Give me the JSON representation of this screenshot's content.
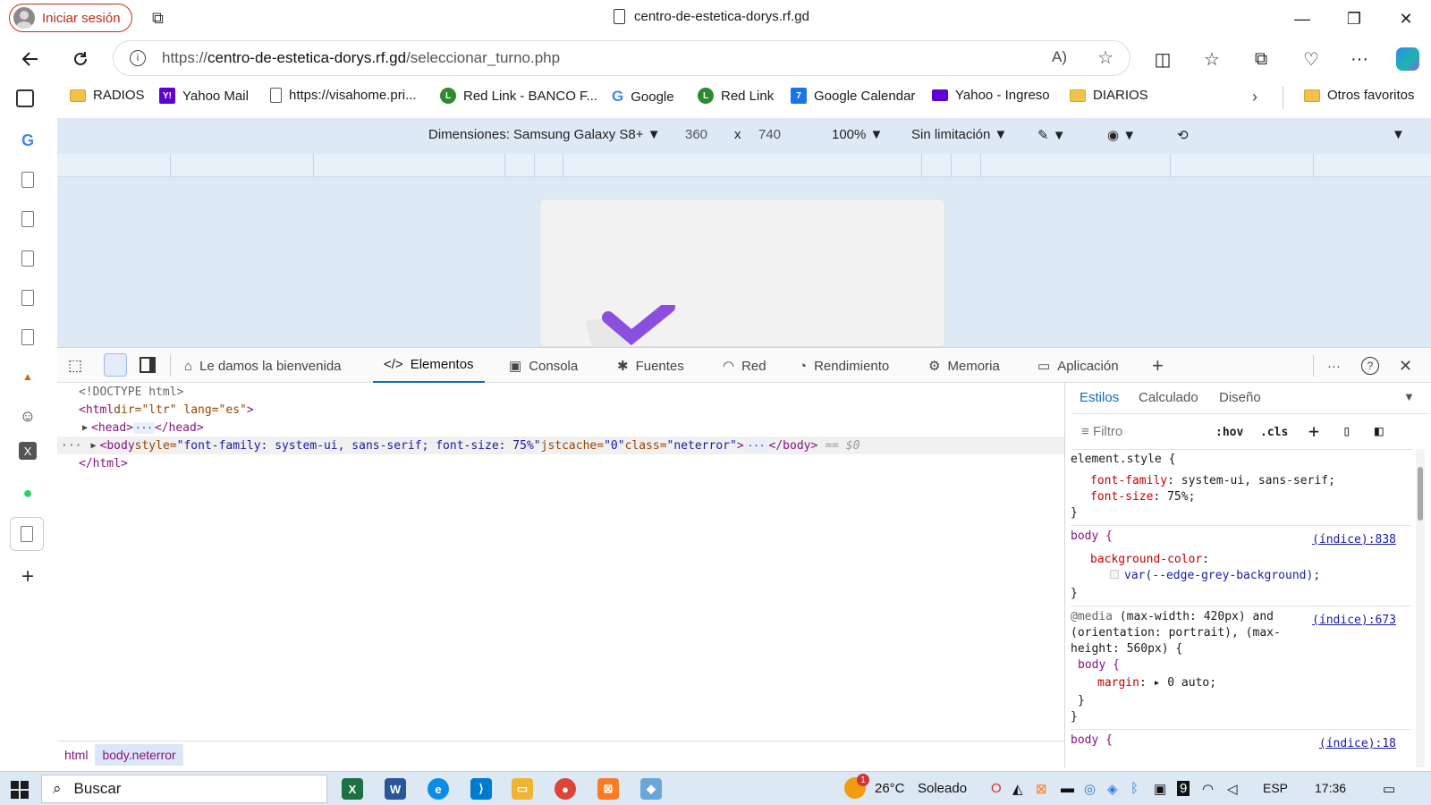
{
  "window": {
    "signin_label": "Iniciar sesión",
    "tab_title": "centro-de-estetica-dorys.rf.gd",
    "controls": {
      "minimize": "—",
      "restore": "❐",
      "close": "✕"
    }
  },
  "address": {
    "scheme": "https://",
    "host": "centro-de-estetica-dorys.rf.gd",
    "path": "/seleccionar_turno.php"
  },
  "bookmarks": [
    {
      "label": "RADIOS",
      "icon": "folder-icon"
    },
    {
      "label": "Yahoo Mail",
      "icon": "yahoo-icon"
    },
    {
      "label": "https://visahome.pri...",
      "icon": "page-icon"
    },
    {
      "label": "Red Link - BANCO F...",
      "icon": "redlink-icon"
    },
    {
      "label": "Google",
      "icon": "google-icon"
    },
    {
      "label": "Red Link",
      "icon": "redlink-icon"
    },
    {
      "label": "Google Calendar",
      "icon": "calendar-icon"
    },
    {
      "label": "Yahoo - Ingreso",
      "icon": "yahoo-mail-icon"
    },
    {
      "label": "DIARIOS",
      "icon": "folder-icon"
    }
  ],
  "bookmarks_other": "Otros favoritos",
  "emulation": {
    "device_label": "Dimensiones: Samsung Galaxy S8+",
    "width": "360",
    "times": "x",
    "height": "740",
    "zoom": "100%",
    "throttle": "Sin limitación"
  },
  "devtools_tabs": [
    {
      "label": "Le damos la bienvenida",
      "icon": "home-icon",
      "active": false
    },
    {
      "label": "Elementos",
      "icon": "code-icon",
      "active": true
    },
    {
      "label": "Consola",
      "icon": "console-icon",
      "active": false
    },
    {
      "label": "Fuentes",
      "icon": "bug-icon",
      "active": false
    },
    {
      "label": "Red",
      "icon": "wifi-icon",
      "active": false
    },
    {
      "label": "Rendimiento",
      "icon": "performance-icon",
      "active": false
    },
    {
      "label": "Memoria",
      "icon": "memory-icon",
      "active": false
    },
    {
      "label": "Aplicación",
      "icon": "application-icon",
      "active": false
    }
  ],
  "dom": {
    "doctype": "<!DOCTYPE html>",
    "html_open_tag": "<html",
    "html_attrs": " dir=\"ltr\" lang=\"es\"",
    "html_close_bracket": ">",
    "head_open": "<head>",
    "head_close": "</head>",
    "body_open": "<body",
    "body_style_attr": " style=",
    "body_style_val": "\"font-family: system-ui, sans-serif; font-size: 75%\"",
    "body_jst_attr": " jstcache=",
    "body_jst_val": "\"0\"",
    "body_class_attr": " class=",
    "body_class_val": "\"neterror\"",
    "body_gt": ">",
    "body_close": "</body>",
    "body_marker": "== $0",
    "html_close": "</html>",
    "ellipsis": "···"
  },
  "breadcrumbs": [
    "html",
    "body.neterror"
  ],
  "styles_tabs": [
    "Estilos",
    "Calculado",
    "Diseño"
  ],
  "styles_filter_placeholder": "Filtro",
  "styles_hov": ":hov",
  "styles_cls": ".cls",
  "style_rules": {
    "r1_selector": "element.style {",
    "r1_p1": "font-family",
    "r1_v1": ": system-ui, sans-serif;",
    "r1_p2": "font-size",
    "r1_v2": ": 75%;",
    "close": "}",
    "r2_selector": "body {",
    "r2_source": "(índice):838",
    "r2_p1": "background-color",
    "r2_colon": ":",
    "r2_v1": "var(--edge-grey-background);",
    "r3_media_kw": "@media",
    "r3_media_1": " (max-width: 420px) and",
    "r3_media_2": "(orientation: portrait), (max-",
    "r3_media_3": "height: 560px) {",
    "r3_source": "(índice):673",
    "r3_body": "body {",
    "r3_p1": "margin",
    "r3_v1": ": ▸ 0 auto;",
    "r3_inner_close": "}",
    "r4_selector": "body {",
    "r4_source": "(índice):18"
  },
  "taskbar": {
    "search_label": "Buscar",
    "weather_temp": "26°C",
    "weather_text": "Soleado",
    "weather_badge": "1",
    "lang": "ESP",
    "time": "17:36"
  }
}
